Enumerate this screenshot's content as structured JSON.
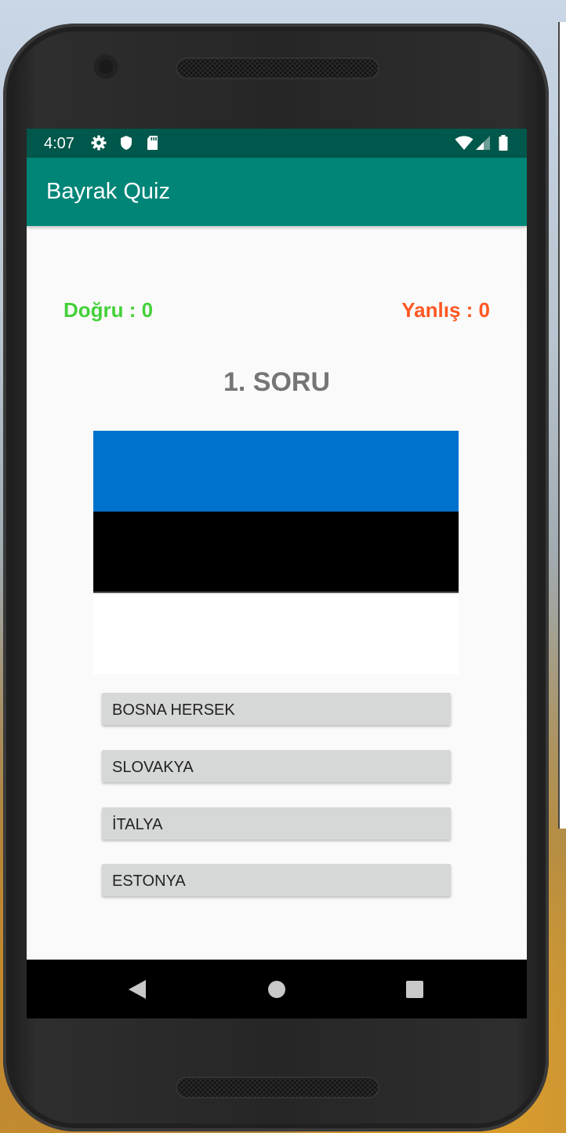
{
  "status_bar": {
    "time": "4:07",
    "icons": [
      "gear-icon",
      "shield-icon",
      "sd-card-icon",
      "wifi-icon",
      "signal-icon",
      "battery-icon"
    ],
    "background": "#00574b"
  },
  "app_bar": {
    "title": "Bayrak Quiz",
    "background": "#008577"
  },
  "score": {
    "correct_label": "Doğru : 0",
    "wrong_label": "Yanlış : 0",
    "correct_color": "#44d03a",
    "wrong_color": "#ff5722"
  },
  "question": {
    "number_label": "1. SORU",
    "flag_colors": [
      "#0072ce",
      "#000000",
      "#ffffff"
    ]
  },
  "answers": [
    "BOSNA HERSEK",
    "SLOVAKYA",
    "İTALYA",
    "ESTONYA"
  ],
  "nav": {
    "icons": [
      "back-icon",
      "home-icon",
      "recents-icon"
    ]
  }
}
